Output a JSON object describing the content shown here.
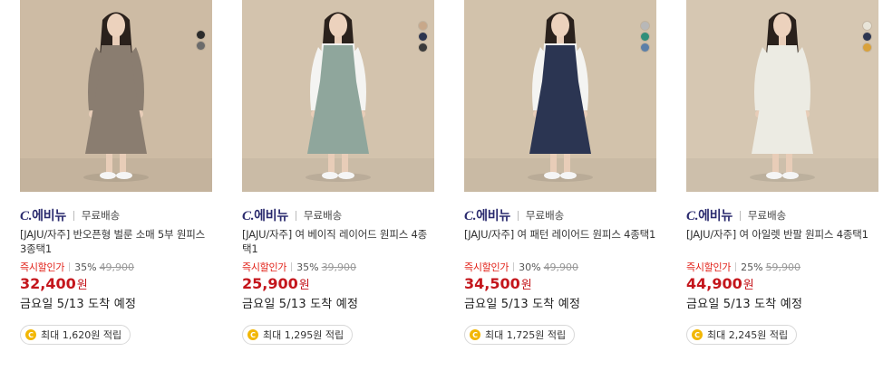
{
  "products": [
    {
      "brand_mark": "C.",
      "brand_name": "에비뉴",
      "shipping": "무료배송",
      "name": "[JAJU/자주] 반오픈형 벌룬 소매 5부 원피스 3종택1",
      "discount_label": "즉시할인가",
      "discount_pct": "35%",
      "original_price": "49,900",
      "price": "32,400",
      "currency": "원",
      "arrival": "금요일 5/13 도착 예정",
      "points": "최대 1,620원 적립",
      "swatches": [
        "#2b2b2b",
        "#6b6b6b"
      ],
      "image": {
        "bg": "#cdbba4",
        "dress": "#8a7d70",
        "sleeves": "#8a7d70",
        "top": "none"
      }
    },
    {
      "brand_mark": "C.",
      "brand_name": "에비뉴",
      "shipping": "무료배송",
      "name": "[JAJU/자주] 여 베이직 레이어드 원피스 4종택1",
      "discount_label": "즉시할인가",
      "discount_pct": "35%",
      "original_price": "39,900",
      "price": "25,900",
      "currency": "원",
      "arrival": "금요일 5/13 도착 예정",
      "points": "최대 1,295원 적립",
      "swatches": [
        "#c8a88a",
        "#2c3550",
        "#3a3a3a"
      ],
      "image": {
        "bg": "#d3c3ad",
        "dress": "#8fa69c",
        "sleeves": "#f4f4f2",
        "top": "#f4f4f2"
      }
    },
    {
      "brand_mark": "C.",
      "brand_name": "에비뉴",
      "shipping": "무료배송",
      "name": "[JAJU/자주] 여 패턴 레이어드 원피스 4종택1",
      "discount_label": "즉시할인가",
      "discount_pct": "30%",
      "original_price": "49,900",
      "price": "34,500",
      "currency": "원",
      "arrival": "금요일 5/13 도착 예정",
      "points": "최대 1,725원 적립",
      "swatches": [
        "#b8b8b8",
        "#2f8f7a",
        "#5b7fa8"
      ],
      "image": {
        "bg": "#d2c2ab",
        "dress": "#2b3552",
        "sleeves": "#f4f4f2",
        "top": "#f4f4f2"
      }
    },
    {
      "brand_mark": "C.",
      "brand_name": "에비뉴",
      "shipping": "무료배송",
      "name": "[JAJU/자주] 여 아일렛 반팔 원피스 4종택1",
      "discount_label": "즉시할인가",
      "discount_pct": "25%",
      "original_price": "59,900",
      "price": "44,900",
      "currency": "원",
      "arrival": "금요일 5/13 도착 예정",
      "points": "최대 2,245원 적립",
      "swatches": [
        "#e8e4d8",
        "#2c3550",
        "#d9a13a"
      ],
      "image": {
        "bg": "#d6c7b2",
        "dress": "#ecebe3",
        "sleeves": "#ecebe3",
        "top": "none"
      }
    }
  ]
}
